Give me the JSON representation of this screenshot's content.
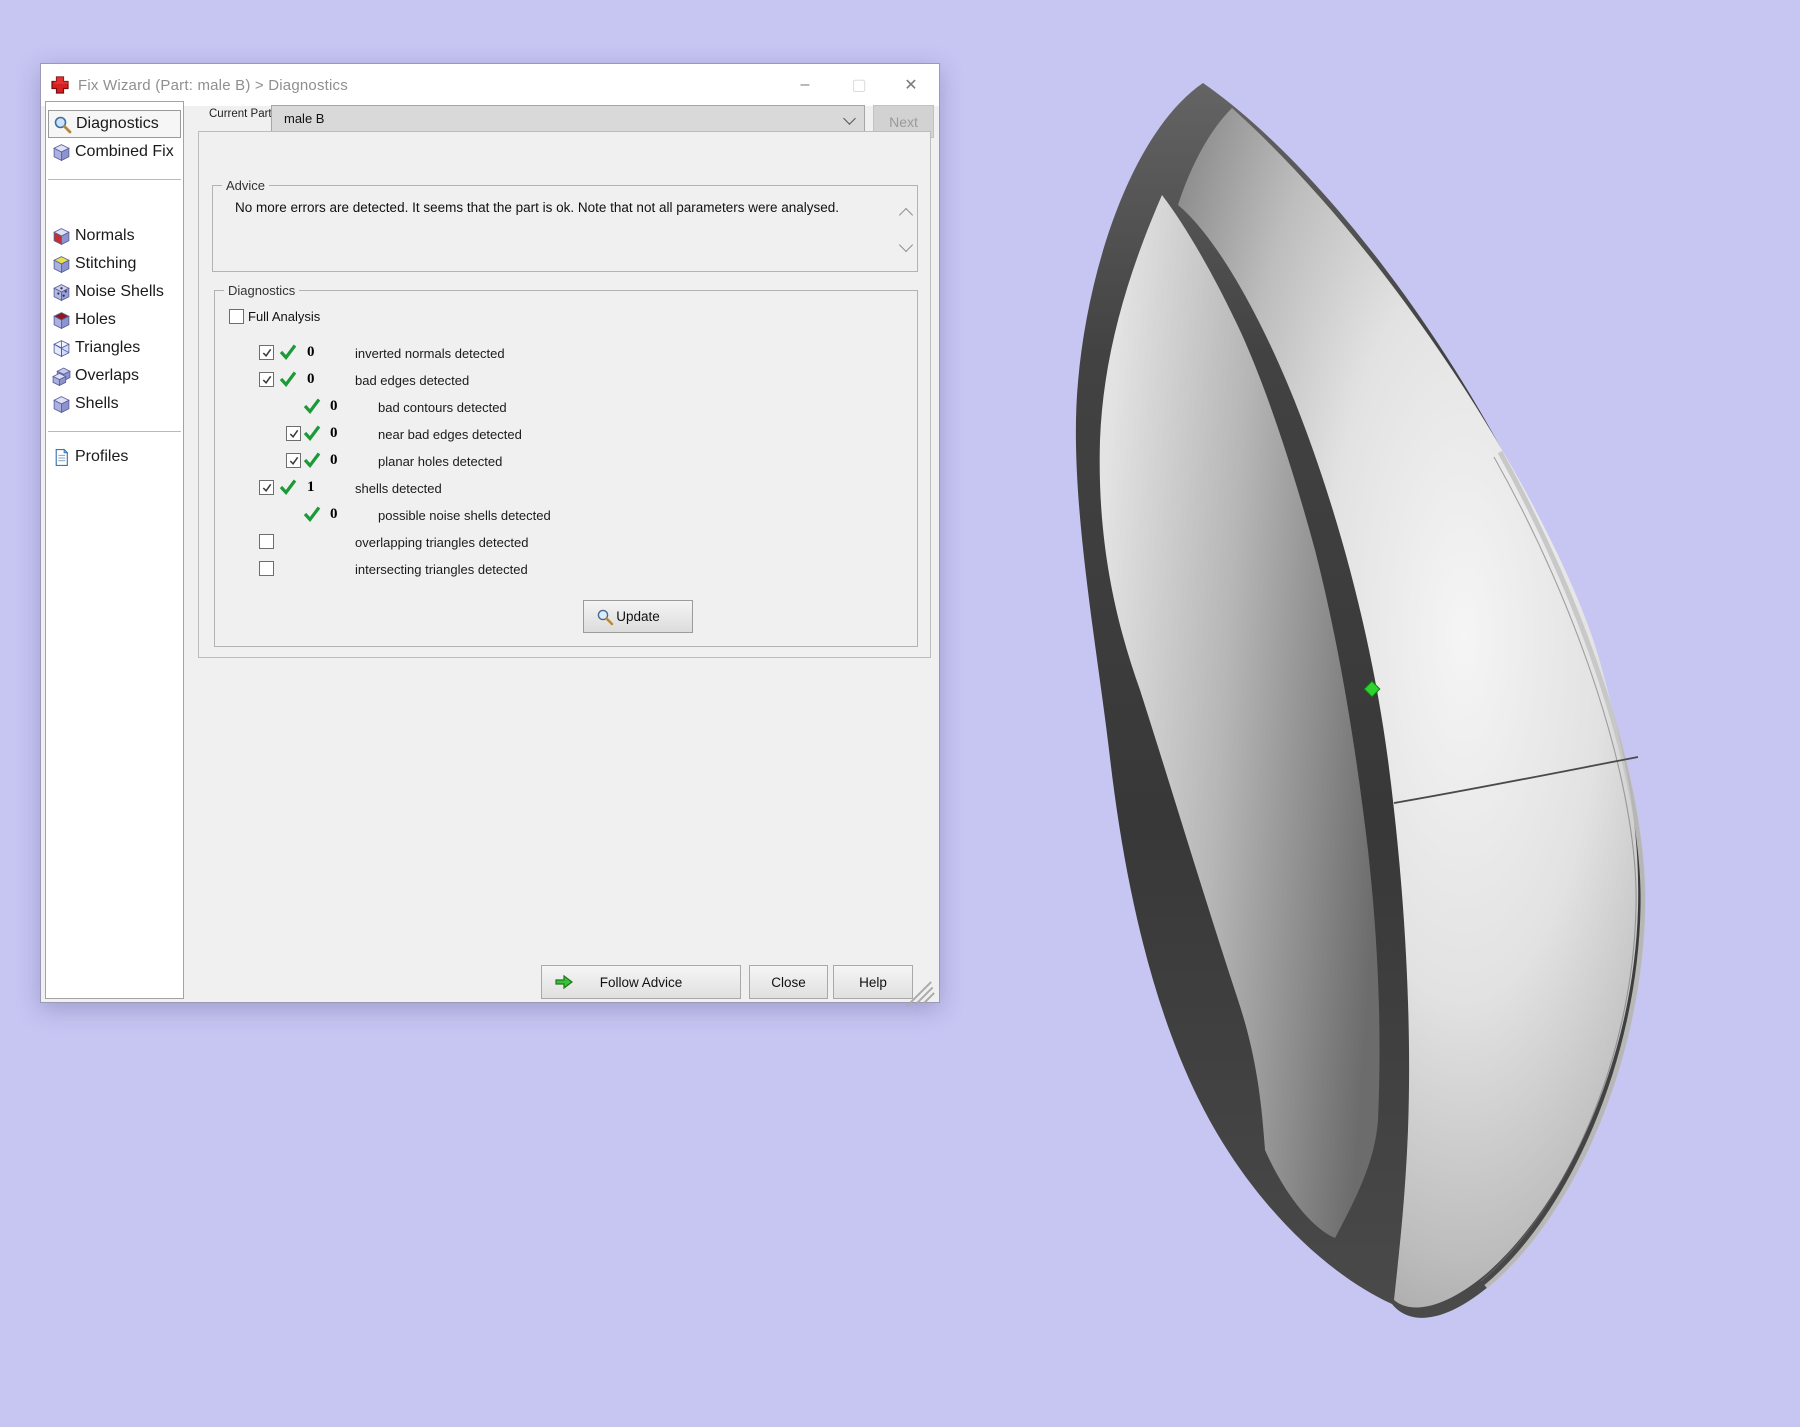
{
  "window": {
    "title": "Fix Wizard (Part: male B) > Diagnostics",
    "app_icon": "red-cross-logo-icon",
    "controls": {
      "minimize": "–",
      "maximize": "▢",
      "close": "✕"
    }
  },
  "toolbar": {
    "current_part_label": "Current Part:",
    "current_part_value": "male B",
    "next_label": "Next",
    "next_enabled": false
  },
  "sidebar": {
    "groups": [
      [
        {
          "label": "Diagnostics",
          "icon": "magnifier-icon",
          "selected": true
        },
        {
          "label": "Combined Fix",
          "icon": "cube-plain-icon",
          "selected": false
        }
      ],
      [
        {
          "label": "Normals",
          "icon": "cube-red-icon",
          "selected": false
        },
        {
          "label": "Stitching",
          "icon": "cube-yellow-icon",
          "selected": false
        },
        {
          "label": "Noise Shells",
          "icon": "cube-dots-icon",
          "selected": false
        },
        {
          "label": "Holes",
          "icon": "cube-darkred-icon",
          "selected": false
        },
        {
          "label": "Triangles",
          "icon": "cube-wire-icon",
          "selected": false
        },
        {
          "label": "Overlaps",
          "icon": "cube-double-icon",
          "selected": false
        },
        {
          "label": "Shells",
          "icon": "cube-plain-icon",
          "selected": false
        }
      ],
      [
        {
          "label": "Profiles",
          "icon": "document-icon",
          "selected": false
        }
      ]
    ]
  },
  "advice": {
    "title": "Advice",
    "text": "No more errors are detected. It seems that the part is ok. Note that not all parameters were analysed."
  },
  "diagnostics": {
    "title": "Diagnostics",
    "full_analysis_label": "Full Analysis",
    "full_analysis_checked": false,
    "check_color": "#1c9a38",
    "rows": [
      {
        "indent": 1,
        "checkbox": true,
        "checked": true,
        "status": "green-check-icon",
        "count": "0",
        "label": "inverted normals detected"
      },
      {
        "indent": 1,
        "checkbox": true,
        "checked": true,
        "status": "green-check-icon",
        "count": "0",
        "label": "bad edges detected"
      },
      {
        "indent": 2,
        "checkbox": false,
        "checked": false,
        "status": "green-check-icon",
        "count": "0",
        "label": "bad contours detected"
      },
      {
        "indent": 2,
        "checkbox": true,
        "checked": true,
        "status": "green-check-icon",
        "count": "0",
        "label": "near bad edges detected"
      },
      {
        "indent": 2,
        "checkbox": true,
        "checked": true,
        "status": "green-check-icon",
        "count": "0",
        "label": "planar holes detected"
      },
      {
        "indent": 1,
        "checkbox": true,
        "checked": true,
        "status": "green-check-icon",
        "count": "1",
        "label": "shells detected"
      },
      {
        "indent": 2,
        "checkbox": false,
        "checked": false,
        "status": "green-check-icon",
        "count": "0",
        "label": "possible noise shells detected"
      },
      {
        "indent": 1,
        "checkbox": true,
        "checked": false,
        "status": "blue-dot-icon",
        "count": "",
        "label": "overlapping triangles detected"
      },
      {
        "indent": 1,
        "checkbox": true,
        "checked": false,
        "status": "blue-dot-icon",
        "count": "",
        "label": "intersecting triangles detected"
      }
    ],
    "update_label": "Update",
    "update_icon": "magnifier-icon"
  },
  "footer": {
    "follow_advice_label": "Follow Advice",
    "follow_advice_icon": "green-arrow-icon",
    "close_label": "Close",
    "help_label": "Help"
  },
  "viewport": {
    "description": "gray shaded 3D ring / shell model on lavender background",
    "background_color": "#c7c5f2",
    "marker_color": "#2fd32f"
  }
}
